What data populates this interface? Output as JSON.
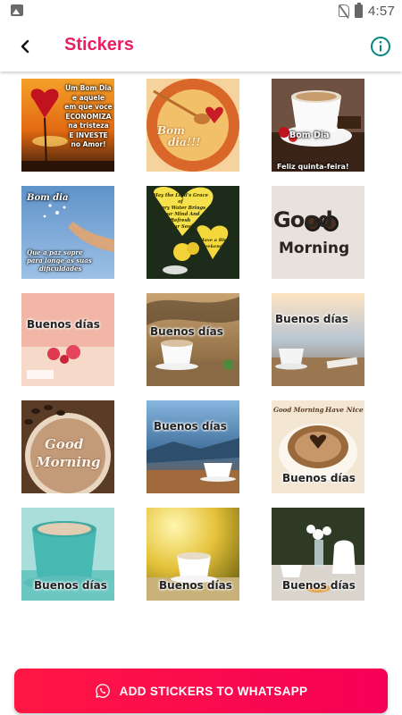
{
  "status_bar": {
    "time": "4:57"
  },
  "app_bar": {
    "title": "Stickers"
  },
  "colors": {
    "accent": "#e91e63",
    "info_icon": "#00897b",
    "button_start": "#ff1744",
    "button_end": "#f50057"
  },
  "stickers": [
    {
      "lines": [
        "Um Bom Dia",
        "e aquele",
        "em que voce",
        "ECONOMIZA",
        "na tristeza",
        "E INVESTE",
        "no Amor!"
      ]
    },
    {
      "lines": [
        "Bom",
        "dia!!!"
      ]
    },
    {
      "lines": [
        "Bom Dia",
        "Feliz quinta-feira!"
      ]
    },
    {
      "lines": [
        "Bom dia",
        "Que a paz sopre",
        "para longe as suas",
        "dificuldades"
      ]
    },
    {
      "lines": [
        "May the Lord's Grace of",
        "Every Water Brings",
        "your Mind And",
        "Refresh",
        "Your Soul",
        "Have a Blessed",
        "Weekend"
      ]
    },
    {
      "lines": [
        "Good",
        "Morning"
      ]
    },
    {
      "lines": [
        "Buenos días"
      ]
    },
    {
      "lines": [
        "Buenos días"
      ]
    },
    {
      "lines": [
        "Buenos días"
      ]
    },
    {
      "lines": [
        "Good",
        "Morning"
      ]
    },
    {
      "lines": [
        "Buenos días"
      ]
    },
    {
      "lines": [
        "Good Morning",
        "Have Nice",
        "Buenos días"
      ]
    },
    {
      "lines": [
        "Buenos días"
      ]
    },
    {
      "lines": [
        "Buenos días"
      ]
    },
    {
      "lines": [
        "Buenos días"
      ]
    }
  ],
  "primary_action": {
    "label": "ADD STICKERS TO WHATSAPP",
    "icon": "whatsapp-icon"
  }
}
